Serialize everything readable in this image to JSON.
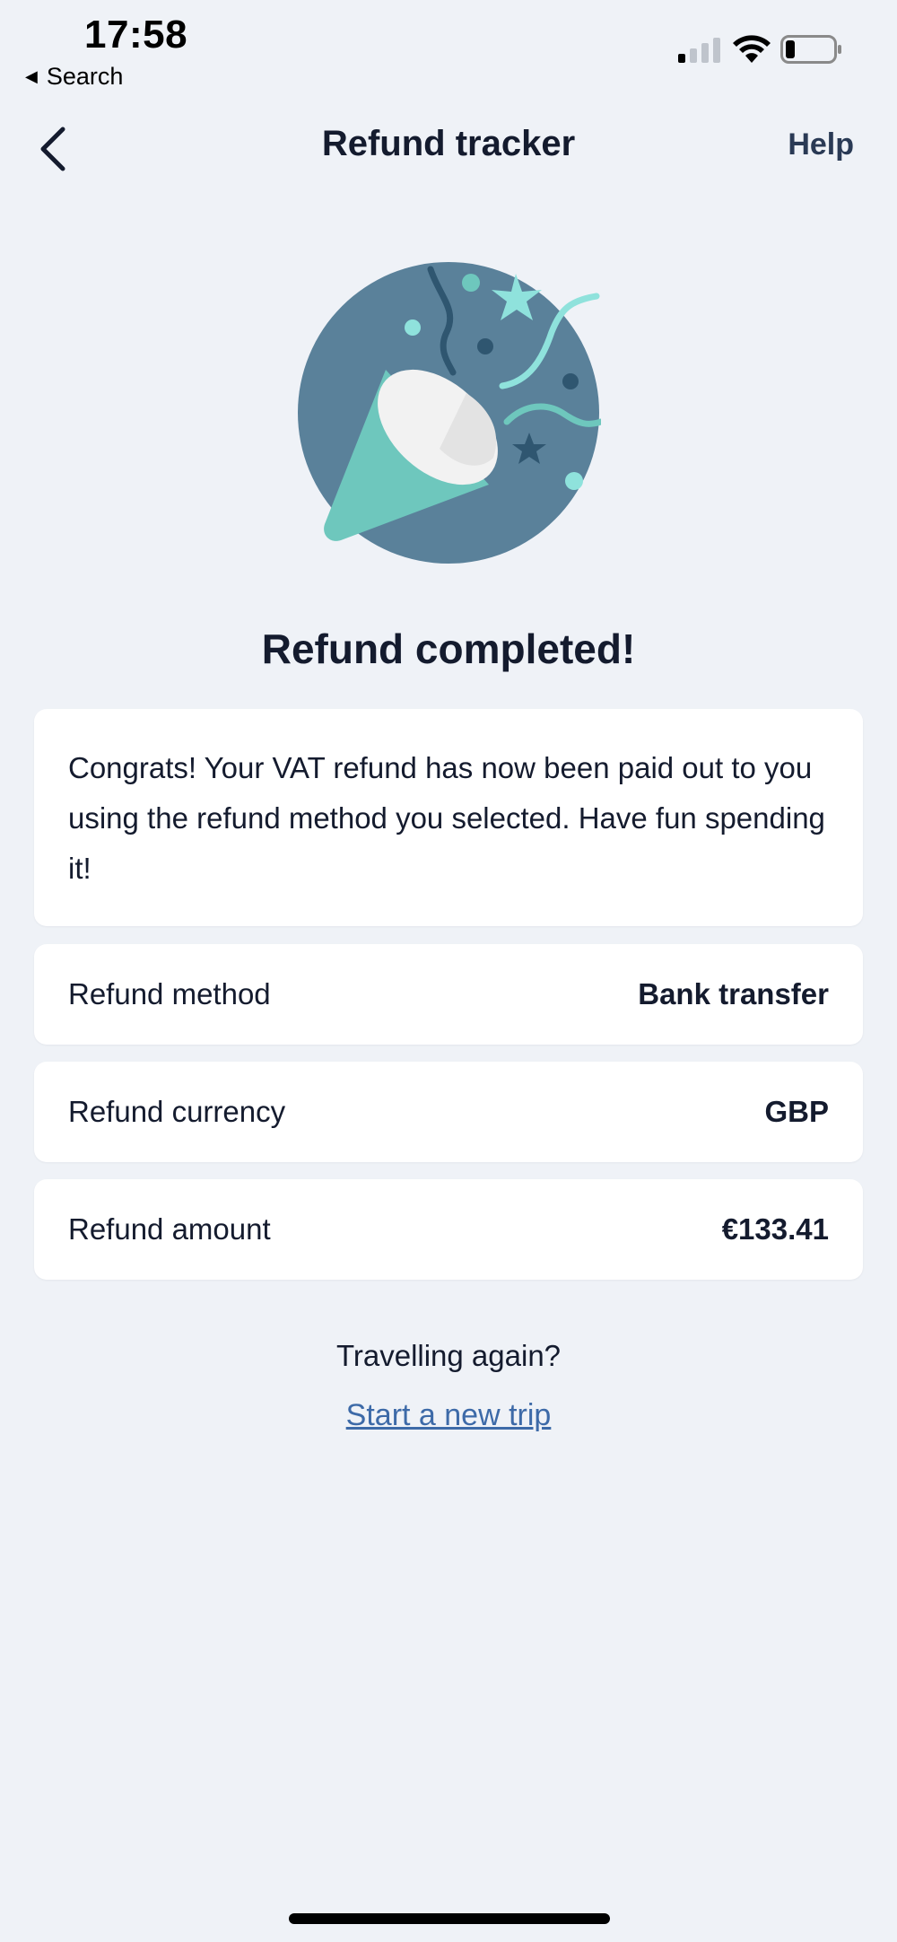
{
  "status_bar": {
    "time": "17:58",
    "back_app": "Search"
  },
  "nav": {
    "title": "Refund tracker",
    "help_label": "Help",
    "back_icon": "chevron-left-icon"
  },
  "illustration": {
    "icon": "party-popper-icon",
    "colors": {
      "circle": "#5a819a",
      "cone": "#6ec7bd",
      "cone_mouth": "#f2f2f2",
      "confetti_light": "#8fe2dc",
      "confetti_dark": "#2f5670"
    }
  },
  "headline": "Refund completed!",
  "message": "Congrats! Your VAT refund has now been paid out to you using the refund method you selected. Have fun spending it!",
  "details": {
    "method": {
      "label": "Refund method",
      "value": "Bank transfer"
    },
    "currency": {
      "label": "Refund currency",
      "value": "GBP"
    },
    "amount": {
      "label": "Refund amount",
      "value": "€133.41"
    }
  },
  "footer": {
    "question": "Travelling again?",
    "link": "Start a new trip"
  },
  "colors": {
    "background": "#eff2f7",
    "text": "#141b2e",
    "link": "#3d6aa8"
  }
}
